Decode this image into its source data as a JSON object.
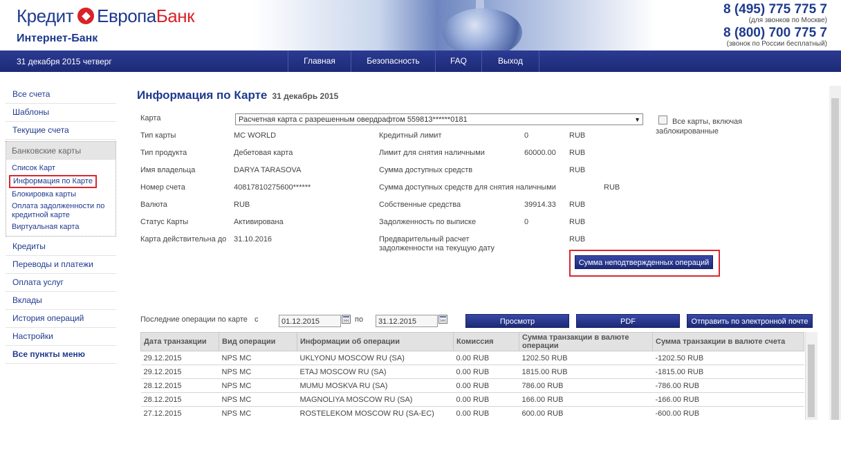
{
  "header": {
    "logo_part1": "Кредит",
    "logo_part2": "Европа",
    "logo_part3": "Банк",
    "subtitle": "Интернет-Банк",
    "phone1": "8 (495) 775 775 7",
    "phone1_note": "(для звонков по Москве)",
    "phone2": "8 (800) 700 775 7",
    "phone2_note": "(звонок по России бесплатный)"
  },
  "nav": {
    "date": "31 декабря 2015 четверг",
    "items": [
      "Главная",
      "Безопасность",
      "FAQ",
      "Выход"
    ]
  },
  "sidebar": {
    "top_items": [
      "Все счета",
      "Шаблоны",
      "Текущие счета"
    ],
    "group_title": "Банковские карты",
    "group_items": [
      "Список Карт",
      "Информация по Карте",
      "Блокировка карты",
      "Оплата задолженности по кредитной карте",
      "Виртуальная карта"
    ],
    "bottom_items": [
      "Кредиты",
      "Переводы и платежи",
      "Оплата услуг",
      "Вклады",
      "История операций",
      "Настройки"
    ],
    "all_items": "Все пункты меню"
  },
  "main": {
    "title": "Информация по Карте",
    "title_date": "31 декабрь 2015",
    "card_label": "Карта",
    "card_value": "Расчетная карта с разрешенным овердрафтом 559813******0181",
    "all_cards_label": "Все карты, включая заблокированные",
    "left_fields": [
      {
        "label": "Тип карты",
        "value": "MC WORLD"
      },
      {
        "label": "Тип продукта",
        "value": "Дебетовая карта"
      },
      {
        "label": "Имя владельца",
        "value": "DARYA TARASOVA"
      },
      {
        "label": "Номер счета",
        "value": "40817810275600******"
      },
      {
        "label": "Валюта",
        "value": "RUB"
      },
      {
        "label": "Статус Карты",
        "value": "Активирована"
      },
      {
        "label": "Карта действительна до",
        "value": "31.10.2016"
      }
    ],
    "right_fields": [
      {
        "label": "Кредитный лимит",
        "value": "0",
        "currency": "RUB"
      },
      {
        "label": "Лимит для снятия наличными",
        "value": "60000.00",
        "currency": "RUB"
      },
      {
        "label": "Сумма доступных средств",
        "value": "",
        "currency": "RUB"
      },
      {
        "label": "Сумма доступных средств для снятия наличными",
        "value": "",
        "currency": "RUB"
      },
      {
        "label": "Собственные средства",
        "value": "39914.33",
        "currency": "RUB"
      },
      {
        "label": "Задолженность по выписке",
        "value": "0",
        "currency": "RUB"
      },
      {
        "label": "Предварительный расчет задолженности на текущую дату",
        "value": "",
        "currency": "RUB"
      }
    ],
    "unconfirmed_button": "Сумма неподтвержденных операций",
    "ops_label": "Последние операции по карте",
    "from_label": "с",
    "to_label": "по",
    "date_from": "01.12.2015",
    "date_to": "31.12.2015",
    "view_button": "Просмотр",
    "pdf_button": "PDF",
    "email_button": "Отправить по электронной почте"
  },
  "table": {
    "headers": [
      "Дата транзакции",
      "Вид операции",
      "Информации об операции",
      "Комиссия",
      "Сумма транзакции в валюте операции",
      "Сумма транзакции в валюте счета"
    ],
    "rows": [
      [
        "29.12.2015",
        "NPS MC",
        "UKLYONU MOSCOW RU (SA)",
        "0.00 RUB",
        "1202.50 RUB",
        "-1202.50 RUB"
      ],
      [
        "29.12.2015",
        "NPS MC",
        "ETAJ MOSCOW RU (SA)",
        "0.00 RUB",
        "1815.00 RUB",
        "-1815.00 RUB"
      ],
      [
        "28.12.2015",
        "NPS MC",
        "MUMU MOSKVA RU (SA)",
        "0.00 RUB",
        "786.00 RUB",
        "-786.00 RUB"
      ],
      [
        "28.12.2015",
        "NPS MC",
        "MAGNOLIYA MOSCOW RU (SA)",
        "0.00 RUB",
        "166.00 RUB",
        "-166.00 RUB"
      ],
      [
        "27.12.2015",
        "NPS MC",
        "ROSTELEKOM MOSCOW RU (SA-EC)",
        "0.00 RUB",
        "600.00 RUB",
        "-600.00 RUB"
      ]
    ]
  }
}
